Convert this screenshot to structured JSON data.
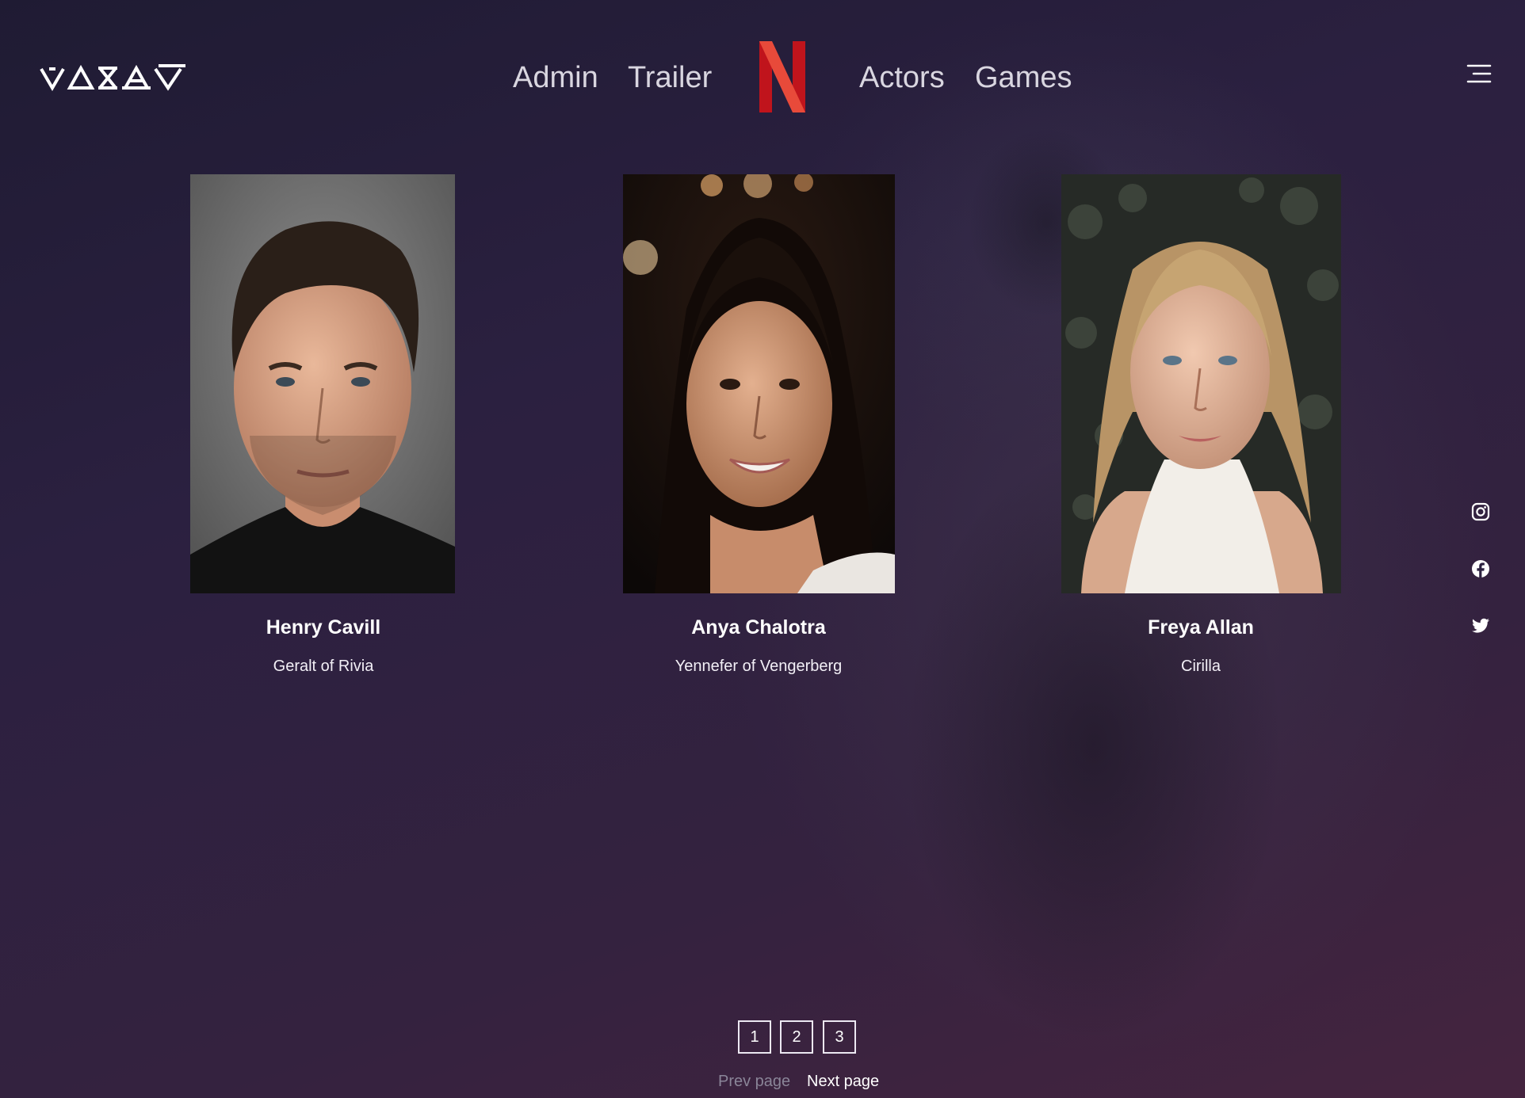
{
  "brand": {
    "logo_icon": "witcher-runes-logo",
    "accent_logo_icon": "netflix-n-logo",
    "netflix_color": "#e50914"
  },
  "nav": {
    "items": [
      {
        "label": "Admin"
      },
      {
        "label": "Trailer"
      },
      {
        "label": "Actors"
      },
      {
        "label": "Games"
      }
    ],
    "menu_icon": "hamburger-menu-icon"
  },
  "social": {
    "items": [
      {
        "icon": "instagram-icon"
      },
      {
        "icon": "facebook-icon"
      },
      {
        "icon": "twitter-icon"
      }
    ]
  },
  "actors": [
    {
      "name": "Henry Cavill",
      "role": "Geralt of Rivia"
    },
    {
      "name": "Anya Chalotra",
      "role": "Yennefer of Vengerberg"
    },
    {
      "name": "Freya Allan",
      "role": "Cirilla"
    }
  ],
  "pagination": {
    "pages": [
      "1",
      "2",
      "3"
    ],
    "prev_label": "Prev page",
    "next_label": "Next page"
  },
  "colors": {
    "background_top": "#1f1b33",
    "background_bottom": "#45243f",
    "text": "#ffffff",
    "disabled_text": "#8a8598"
  }
}
